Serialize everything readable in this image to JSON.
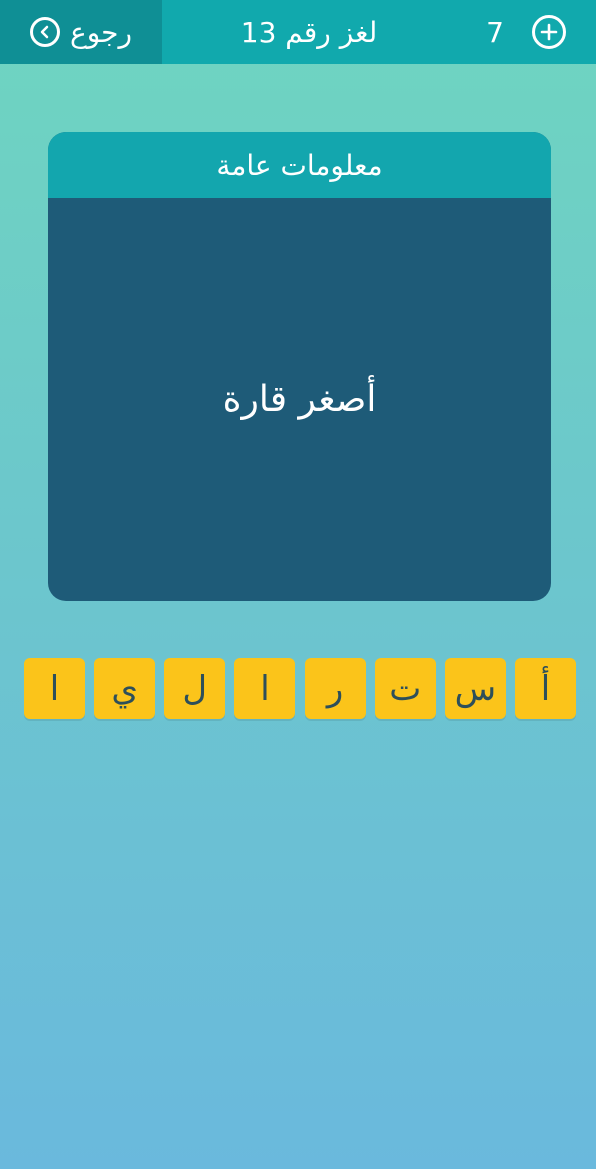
{
  "header": {
    "back_label": "رجوع",
    "title": "لغز رقم 13",
    "coins": "7"
  },
  "card": {
    "category": "معلومات عامة",
    "question": "أصغر قارة"
  },
  "tiles": [
    "أ",
    "س",
    "ت",
    "ر",
    "ا",
    "ل",
    "ي",
    "ا"
  ],
  "colors": {
    "topbar": "#11a9ad",
    "back_button": "#0f8f95",
    "card_header": "#13a6ae",
    "card_body": "#1e5b78",
    "tile": "#fbc41a",
    "tile_text": "#2d4f5a"
  },
  "icons": {
    "back": "chevron-left-icon",
    "add": "plus-icon"
  }
}
